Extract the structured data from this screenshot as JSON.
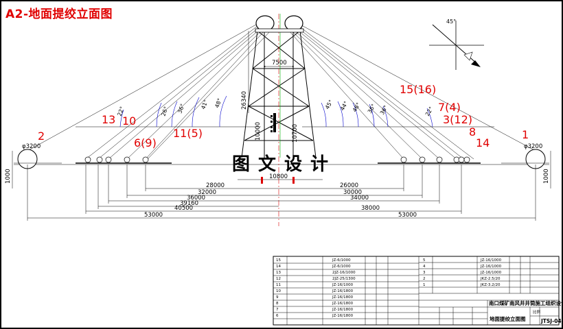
{
  "title": "A2-地面提绞立面图",
  "watermark": "图文设计",
  "compass": {
    "angle": "45°"
  },
  "tower": {
    "width": "7500",
    "height": "26340",
    "lower_left": "10000",
    "lower_right": "10700",
    "base": "10800"
  },
  "diameters": {
    "left": "φ3200",
    "right": "φ3200"
  },
  "elevation": "1000",
  "hoist_labels": [
    "2",
    "13",
    "10",
    "6(9)",
    "11(5)",
    "15(16)",
    "7(4)",
    "3(12)",
    "8",
    "14",
    "1"
  ],
  "angles_left": [
    "22°",
    "26°",
    "36°",
    "41°",
    "48°"
  ],
  "angles_right": [
    "45°",
    "44°",
    "46°",
    "36°",
    "36°",
    "22°"
  ],
  "dims_left": [
    "28000",
    "32000",
    "36000",
    "39160",
    "40500",
    "53000"
  ],
  "dims_right": [
    "26000",
    "30000",
    "34000",
    "38000",
    "53000"
  ],
  "table_rows": [
    {
      "no": "15",
      "code": "JZ-6/1000"
    },
    {
      "no": "14",
      "code": "JZ-6/1000"
    },
    {
      "no": "13",
      "code": "2JZ-16/1000"
    },
    {
      "no": "12",
      "code": "2JZ-25/1300"
    },
    {
      "no": "11",
      "code": "JZ-16/1000"
    },
    {
      "no": "10",
      "code": "JZ-16/1800"
    },
    {
      "no": "9",
      "code": "JZ-16/1800"
    },
    {
      "no": "8",
      "code": "JZ-16/1800"
    },
    {
      "no": "7",
      "code": "JZ-16/1800"
    },
    {
      "no": "6",
      "code": "JZ-16/1800"
    }
  ],
  "table_rows2": [
    {
      "no": "5",
      "code": "JZ-16/1000"
    },
    {
      "no": "4",
      "code": "JZ-16/1000"
    },
    {
      "no": "3",
      "code": "JZ-16/1000"
    },
    {
      "no": "2",
      "code": "JKZ-2.5/20"
    },
    {
      "no": "1",
      "code": "JKZ-3.2/20"
    }
  ],
  "project_title": "南口煤矿南风井井筒施工组织设计",
  "drawing_title": "地面提绞立面图",
  "drawing_no": "JTSJ-04",
  "tb_labels": {
    "scale": "比例",
    "weight": "重量",
    "qty": "数量"
  }
}
